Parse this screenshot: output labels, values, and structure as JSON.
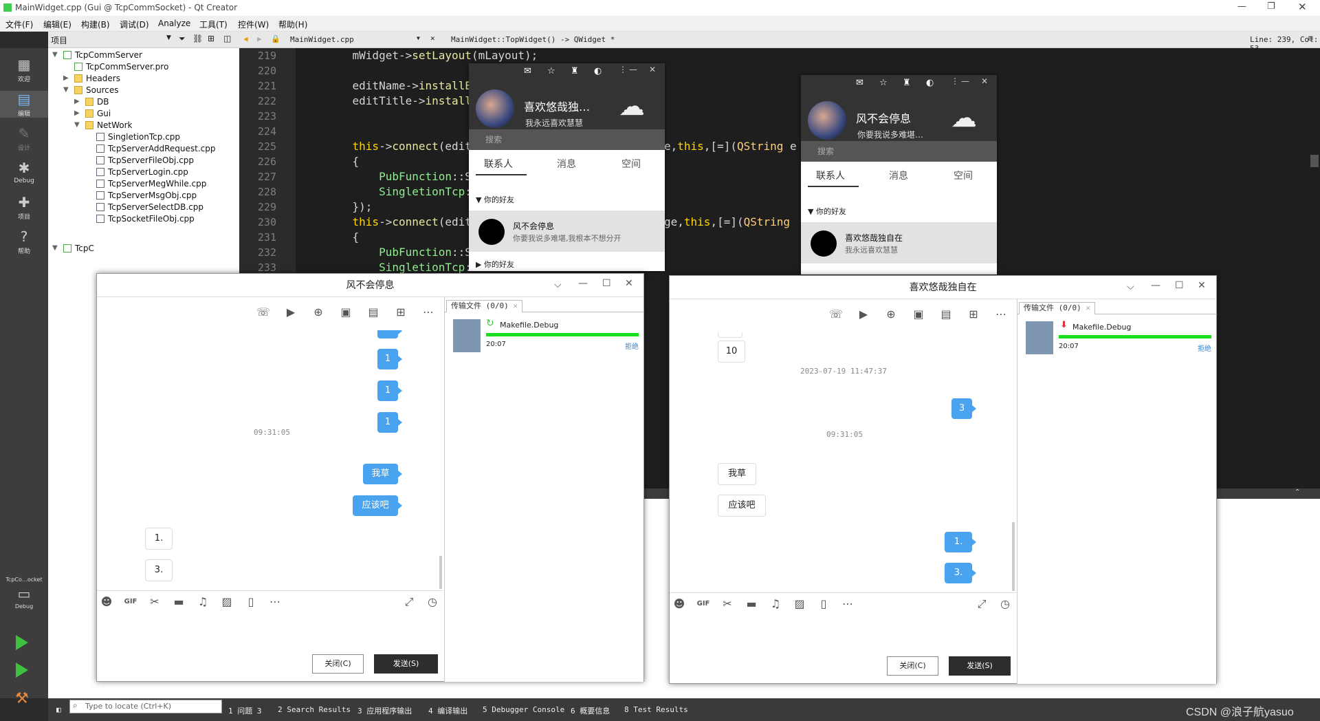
{
  "window": {
    "title": "MainWidget.cpp (Gui @ TcpCommSocket) - Qt Creator"
  },
  "menu": [
    "文件(F)",
    "编辑(E)",
    "构建(B)",
    "调试(D)",
    "Analyze",
    "工具(T)",
    "控件(W)",
    "帮助(H)"
  ],
  "modes": [
    "欢迎",
    "编辑",
    "设计",
    "Debug",
    "项目",
    "帮助"
  ],
  "kit": {
    "name": "TcpCo…ocket",
    "config": "Debug"
  },
  "project_panel": {
    "title": "项目"
  },
  "tree": [
    {
      "label": "TcpCommServer",
      "type": "pro"
    },
    {
      "label": "TcpCommServer.pro",
      "type": "pro"
    },
    {
      "label": "Headers",
      "type": "fold"
    },
    {
      "label": "Sources",
      "type": "fold"
    },
    {
      "label": "DB",
      "type": "fold"
    },
    {
      "label": "Gui",
      "type": "fold"
    },
    {
      "label": "NetWork",
      "type": "fold"
    },
    {
      "label": "SingletionTcp.cpp",
      "type": "cpp"
    },
    {
      "label": "TcpServerAddRequest.cpp",
      "type": "cpp"
    },
    {
      "label": "TcpServerFileObj.cpp",
      "type": "cpp"
    },
    {
      "label": "TcpServerLogin.cpp",
      "type": "cpp"
    },
    {
      "label": "TcpServerMegWhile.cpp",
      "type": "cpp"
    },
    {
      "label": "TcpServerMsgObj.cpp",
      "type": "cpp"
    },
    {
      "label": "TcpServerSelectDB.cpp",
      "type": "cpp"
    },
    {
      "label": "TcpSocketFileObj.cpp",
      "type": "cpp"
    },
    {
      "label": "TcpC",
      "type": "pro"
    }
  ],
  "editor": {
    "file": "MainWidget.cpp",
    "function": "MainWidget::TopWidget() -> QWidget *",
    "position": "Line: 239, Col: 53"
  },
  "code_lines": [
    {
      "n": "219",
      "t": "    mWidget->setLayout(mLayout);"
    },
    {
      "n": "220",
      "t": ""
    },
    {
      "n": "221",
      "t": "    editName->installEven"
    },
    {
      "n": "222",
      "t": "    editTitle->installEve"
    },
    {
      "n": "223",
      "t": ""
    },
    {
      "n": "224",
      "t": ""
    },
    {
      "n": "225",
      "t": "    this->connect(editNam",
      "tail": "e,this,[=](QString e"
    },
    {
      "n": "226",
      "t": "    {"
    },
    {
      "n": "227",
      "t": "        PubFunction::SetN"
    },
    {
      "n": "228",
      "t": "        SingletionTcp::Ge"
    },
    {
      "n": "229",
      "t": "    });"
    },
    {
      "n": "230",
      "t": "    this->connect(editTit",
      "tail": "ge,this,[=](QString"
    },
    {
      "n": "231",
      "t": "    {"
    },
    {
      "n": "232",
      "t": "        PubFunction::SetS"
    },
    {
      "n": "233",
      "t": "        SingletionTcp::Ge"
    }
  ],
  "bottom": {
    "locate_placeholder": "Type to locate (Ctrl+K)",
    "tabs": [
      "1 问题 3",
      "2 Search Results",
      "3 应用程序输出",
      "4 编译输出",
      "5 Debugger Console",
      "6 概要信息",
      "8 Test Results"
    ],
    "watermark": "CSDN @浪子航yasuo"
  },
  "qq_left": {
    "name": "喜欢悠哉独…",
    "signature": "我永远喜欢慧慧",
    "search": "搜索",
    "tabs": [
      "联系人",
      "消息",
      "空间"
    ],
    "group": "你的好友",
    "friend_name": "风不会停息",
    "friend_sig": "你要我说多难堪,我根本不想分开",
    "group2": "你的好友"
  },
  "qq_right": {
    "name": "风不会停息",
    "signature": "你要我说多难堪…",
    "search": "搜索",
    "tabs": [
      "联系人",
      "消息",
      "空间"
    ],
    "group": "你的好友",
    "friend_name": "喜欢悠哉独自在",
    "friend_sig": "我永远喜欢慧慧"
  },
  "chat_left": {
    "title": "风不会停息",
    "messages": [
      {
        "side": "right",
        "text": "1"
      },
      {
        "side": "right",
        "text": "1"
      },
      {
        "side": "right",
        "text": "1"
      },
      {
        "side": "time",
        "text": "09:31:05"
      },
      {
        "side": "right",
        "text": "我草"
      },
      {
        "side": "right",
        "text": "应该吧"
      },
      {
        "side": "left",
        "text": "1."
      },
      {
        "side": "left",
        "text": "3."
      }
    ],
    "file_tab": "传输文件 (0/0)",
    "file_name": "Makefile.Debug",
    "file_time": "20:07",
    "file_action": "拒绝",
    "close": "关闭(C)",
    "send": "发送(S)"
  },
  "chat_right": {
    "title": "喜欢悠哉独自在",
    "messages": [
      {
        "side": "left",
        "text": "10"
      },
      {
        "side": "time",
        "text": "2023-07-19 11:47:37"
      },
      {
        "side": "right",
        "text": "3"
      },
      {
        "side": "time",
        "text": "09:31:05"
      },
      {
        "side": "left",
        "text": "我草"
      },
      {
        "side": "left",
        "text": "应该吧"
      },
      {
        "side": "right",
        "text": "1."
      },
      {
        "side": "right",
        "text": "3."
      }
    ],
    "file_tab": "传输文件 (0/0)",
    "file_name": "Makefile.Debug",
    "file_time": "20:07",
    "file_action": "拒绝",
    "close": "关闭(C)",
    "send": "发送(S)"
  },
  "colors": {
    "bubble": "#4aa3ef",
    "progress": "#18e01b",
    "editor_bg": "#1e1e1e"
  }
}
